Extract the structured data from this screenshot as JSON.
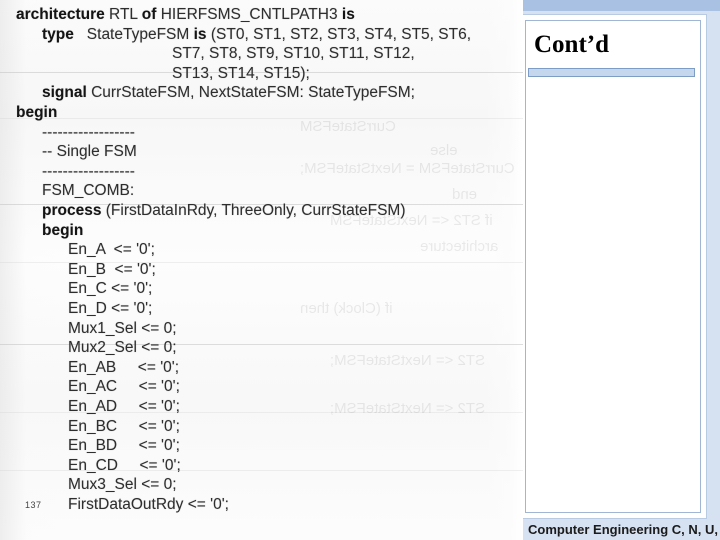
{
  "slide": {
    "title": "Cont’d",
    "footer": "Computer Engineering C, N, U,",
    "page_number": "137",
    "colors": {
      "top_band": "#a9c2e3",
      "background": "#d6e1f1",
      "frame_fill": "#ffffff",
      "frame_border": "#b9cbe3",
      "title_rule_fill": "#c5d7ec",
      "title_rule_border": "#7e9dc4",
      "title_text": "#000000",
      "footer_text": "#1b1b1b",
      "code_text": "#2e2e2e"
    }
  },
  "code_image": {
    "caption": "scanned VHDL source listing",
    "lines": [
      {
        "indent": 0,
        "text": "architecture RTL of HIERFSMS_CNTLPATH3 is",
        "bold_spans": [
          "architecture",
          "of",
          "is"
        ]
      },
      {
        "indent": 1,
        "text": "type   StateTypeFSM is (ST0, ST1, ST2, ST3, ST4, ST5, ST6,",
        "bold_spans": [
          "type",
          "is"
        ]
      },
      {
        "indent": 6,
        "text": "ST7, ST8, ST9, ST10, ST11, ST12,",
        "bold_spans": []
      },
      {
        "indent": 6,
        "text": "ST13, ST14, ST15);",
        "bold_spans": []
      },
      {
        "indent": 1,
        "text": "signal CurrStateFSM, NextStateFSM: StateTypeFSM;",
        "bold_spans": [
          "signal"
        ]
      },
      {
        "indent": 0,
        "text": "begin",
        "bold_spans": [
          "begin"
        ]
      },
      {
        "indent": 1,
        "text": "------------------",
        "bold_spans": []
      },
      {
        "indent": 1,
        "text": "-- Single FSM",
        "bold_spans": []
      },
      {
        "indent": 1,
        "text": "------------------",
        "bold_spans": []
      },
      {
        "indent": 1,
        "text": "FSM_COMB:",
        "bold_spans": []
      },
      {
        "indent": 1,
        "text": "process (FirstDataInRdy, ThreeOnly, CurrStateFSM)",
        "bold_spans": [
          "process"
        ]
      },
      {
        "indent": 1,
        "text": "begin",
        "bold_spans": [
          "begin"
        ]
      },
      {
        "indent": 2,
        "text": "En_A  <= '0';",
        "bold_spans": []
      },
      {
        "indent": 2,
        "text": "En_B  <= '0';",
        "bold_spans": []
      },
      {
        "indent": 2,
        "text": "En_C <= '0';",
        "bold_spans": []
      },
      {
        "indent": 2,
        "text": "En_D <= '0';",
        "bold_spans": []
      },
      {
        "indent": 2,
        "text": "Mux1_Sel <= 0;",
        "bold_spans": []
      },
      {
        "indent": 2,
        "text": "Mux2_Sel <= 0;",
        "bold_spans": []
      },
      {
        "indent": 2,
        "text": "En_AB     <= '0';",
        "bold_spans": []
      },
      {
        "indent": 2,
        "text": "En_AC     <= '0';",
        "bold_spans": []
      },
      {
        "indent": 2,
        "text": "En_AD     <= '0';",
        "bold_spans": []
      },
      {
        "indent": 2,
        "text": "En_BC     <= '0';",
        "bold_spans": []
      },
      {
        "indent": 2,
        "text": "En_BD     <= '0';",
        "bold_spans": []
      },
      {
        "indent": 2,
        "text": "En_CD     <= '0';",
        "bold_spans": []
      },
      {
        "indent": 2,
        "text": "Mux3_Sel <= 0;",
        "bold_spans": []
      },
      {
        "indent": 2,
        "text": "FirstDataOutRdy <= '0';",
        "bold_spans": []
      }
    ],
    "ghost_text": [
      "CurrStateFSM",
      "else",
      "CurrStateFSM = NextStateFSM;",
      "end",
      "if ST2 <= NextStateFSM",
      "architecture",
      "if (Clock) then",
      "ST2 <= NextStateFSM;",
      "ST2 <= NextStateFSM;"
    ]
  }
}
